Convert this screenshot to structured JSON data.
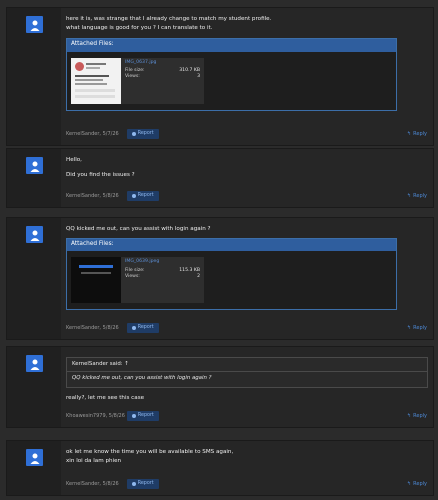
{
  "posts": [
    {
      "text": [
        "here it is, was strange that I already change to match my student profile.",
        "what language is good for you ? I can translate to it."
      ],
      "attachments_title": "Attached Files:",
      "file": {
        "name": "IMG_0637.jpg",
        "size_label": "File size:",
        "size": "310.7 KB",
        "views_label": "Views:",
        "views": "3"
      },
      "byline": "KernelSander, 5/7/26",
      "report": "Report",
      "reply": "Reply"
    },
    {
      "text": [
        "Hello,",
        "",
        "Did you find the issues ?"
      ],
      "byline": "KernelSander, 5/8/26",
      "report": "Report",
      "reply": "Reply"
    },
    {
      "text": [
        "QQ kicked me out, can you assist with login again ?"
      ],
      "attachments_title": "Attached Files:",
      "file": {
        "name": "IMG_0639.jpeg",
        "size_label": "File size:",
        "size": "115.3 KB",
        "views_label": "Views:",
        "views": "2"
      },
      "byline": "KernelSander, 5/8/26",
      "report": "Report",
      "reply": "Reply"
    },
    {
      "quote_author": "KernelSander said: ↑",
      "quote_text": "QQ kicked me out, can you assist with login again ?",
      "text": [
        "really?, let me see this case"
      ],
      "byline": "Khoawesin7979, 5/8/26",
      "report": "Report",
      "reply": "Reply"
    },
    {
      "text": [
        "ok let me know the time you will be available to SMS again,",
        "xin loi da lam phien"
      ],
      "byline": "KernelSander, 5/8/26",
      "report": "Report",
      "reply": "Reply"
    }
  ],
  "colors": {
    "accent": "#2f6fd6",
    "link": "#4d89d6",
    "attach_header": "#2f5e9e"
  }
}
